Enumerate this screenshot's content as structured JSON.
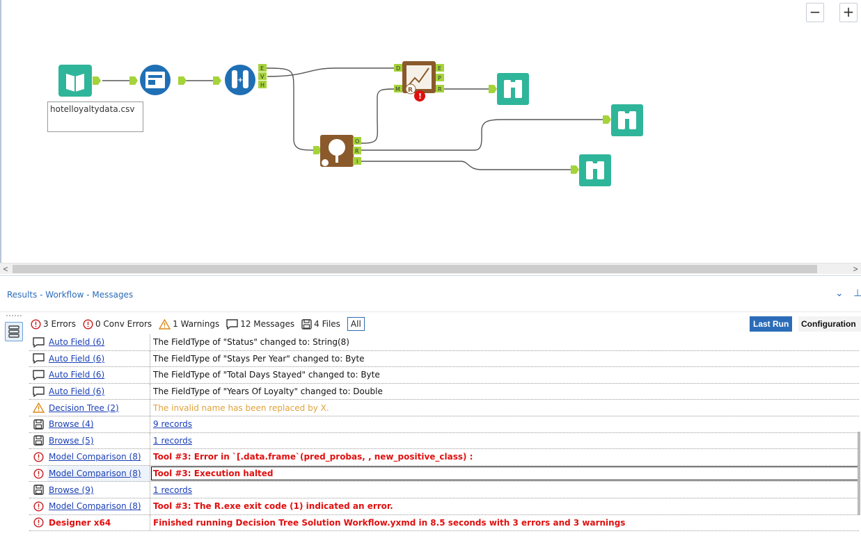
{
  "canvas": {
    "zoom_out": "−",
    "zoom_in": "+",
    "input_file_label": "hotelloyaltydata.csv",
    "formula_anchors": [
      "E",
      "V",
      "H"
    ],
    "tree_anchors": [
      "O",
      "R",
      "I"
    ],
    "model_anchors_in": [
      "D",
      "M"
    ],
    "model_anchors_out": [
      "E",
      "P",
      "R"
    ],
    "tools": [
      {
        "name": "input-data-tool",
        "icon": "book-icon",
        "color": "#2fb59a"
      },
      {
        "name": "select-tool",
        "icon": "select-icon",
        "color": "#1f6fb5"
      },
      {
        "name": "create-samples-tool",
        "icon": "test-tubes-icon",
        "color": "#1f6fb5"
      },
      {
        "name": "model-comparison-tool",
        "icon": "chart-icon",
        "color": "#8a5a2b"
      },
      {
        "name": "decision-tree-tool",
        "icon": "tree-icon",
        "color": "#8a5a2b"
      },
      {
        "name": "browse-tool",
        "icon": "binoculars-icon",
        "color": "#2fb59a"
      }
    ]
  },
  "results": {
    "title": "Results - Workflow - Messages",
    "filters": {
      "errors": "3 Errors",
      "conv_errors": "0 Conv Errors",
      "warnings": "1 Warnings",
      "messages": "12 Messages",
      "files": "4 Files",
      "all": "All"
    },
    "last_run": "Last Run",
    "configuration": "Configuration",
    "rows": [
      {
        "type": "message",
        "tool": "Auto Field (6)",
        "message": "The FieldType of \"Status\" changed to: String(8)"
      },
      {
        "type": "message",
        "tool": "Auto Field (6)",
        "message": "The FieldType of \"Stays Per Year\" changed to: Byte"
      },
      {
        "type": "message",
        "tool": "Auto Field (6)",
        "message": "The FieldType of \"Total Days Stayed\" changed to: Byte"
      },
      {
        "type": "message",
        "tool": "Auto Field (6)",
        "message": "The FieldType of \"Years Of Loyalty\" changed to: Double"
      },
      {
        "type": "warning",
        "tool": "Decision Tree (2)",
        "message": "The invalid name  has been replaced by X."
      },
      {
        "type": "file",
        "tool": "Browse (4)",
        "message": "9 records"
      },
      {
        "type": "file",
        "tool": "Browse (5)",
        "message": "1 records"
      },
      {
        "type": "error",
        "tool": "Model Comparison (8)",
        "message": "Tool #3: Error in `[.data.frame`(pred_probas, , new_positive_class) :"
      },
      {
        "type": "error",
        "tool": "Model Comparison (8)",
        "message": "Tool #3: Execution halted"
      },
      {
        "type": "file",
        "tool": "Browse (9)",
        "message": "1 records"
      },
      {
        "type": "error",
        "tool": "Model Comparison (8)",
        "message": "Tool #3: The R.exe exit code (1) indicated an error."
      },
      {
        "type": "error",
        "tool": "Designer x64",
        "message": "Finished running Decision Tree Solution Workflow.yxmd in 8.5 seconds with 3 errors and 3 warnings"
      }
    ]
  }
}
